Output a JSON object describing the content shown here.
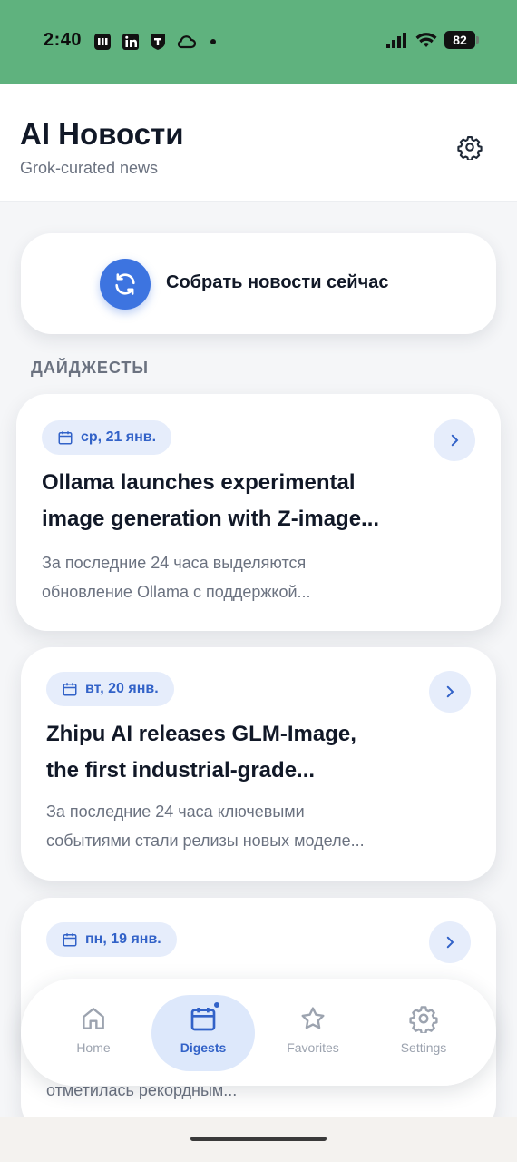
{
  "status_bar": {
    "time": "2:40",
    "battery": "82"
  },
  "header": {
    "title": "AI Новости",
    "subtitle": "Grok-curated news"
  },
  "collect_button": {
    "label": "Собрать новости сейчас"
  },
  "section_title": "ДАЙДЖЕСТЫ",
  "digests": [
    {
      "date": "ср, 21 янв.",
      "title_line1": "Ollama launches experimental",
      "title_line2": "image generation with Z-image...",
      "summary_line1": "За последние 24 часа выделяются",
      "summary_line2": "обновление Ollama с поддержкой..."
    },
    {
      "date": "вт, 20 янв.",
      "title_line1": "Zhipu AI releases GLM-Image,",
      "title_line2": "the first industrial-grade...",
      "summary_line1": "За последние 24 часа ключевыми",
      "summary_line2": "событиями стали релизы новых моделе..."
    },
    {
      "date": "пн, 19 янв.",
      "title_line1": "",
      "summary_line2": "отметилась рекордным..."
    }
  ],
  "bottom_nav": {
    "items": [
      {
        "label": "Home",
        "icon": "home-icon"
      },
      {
        "label": "Digests",
        "icon": "calendar-icon",
        "active": true
      },
      {
        "label": "Favorites",
        "icon": "star-icon"
      },
      {
        "label": "Settings",
        "icon": "gear-icon"
      }
    ]
  },
  "colors": {
    "status_bar": "#5fb27e",
    "accent": "#3d74e0",
    "pill_bg": "#e6edfb"
  }
}
